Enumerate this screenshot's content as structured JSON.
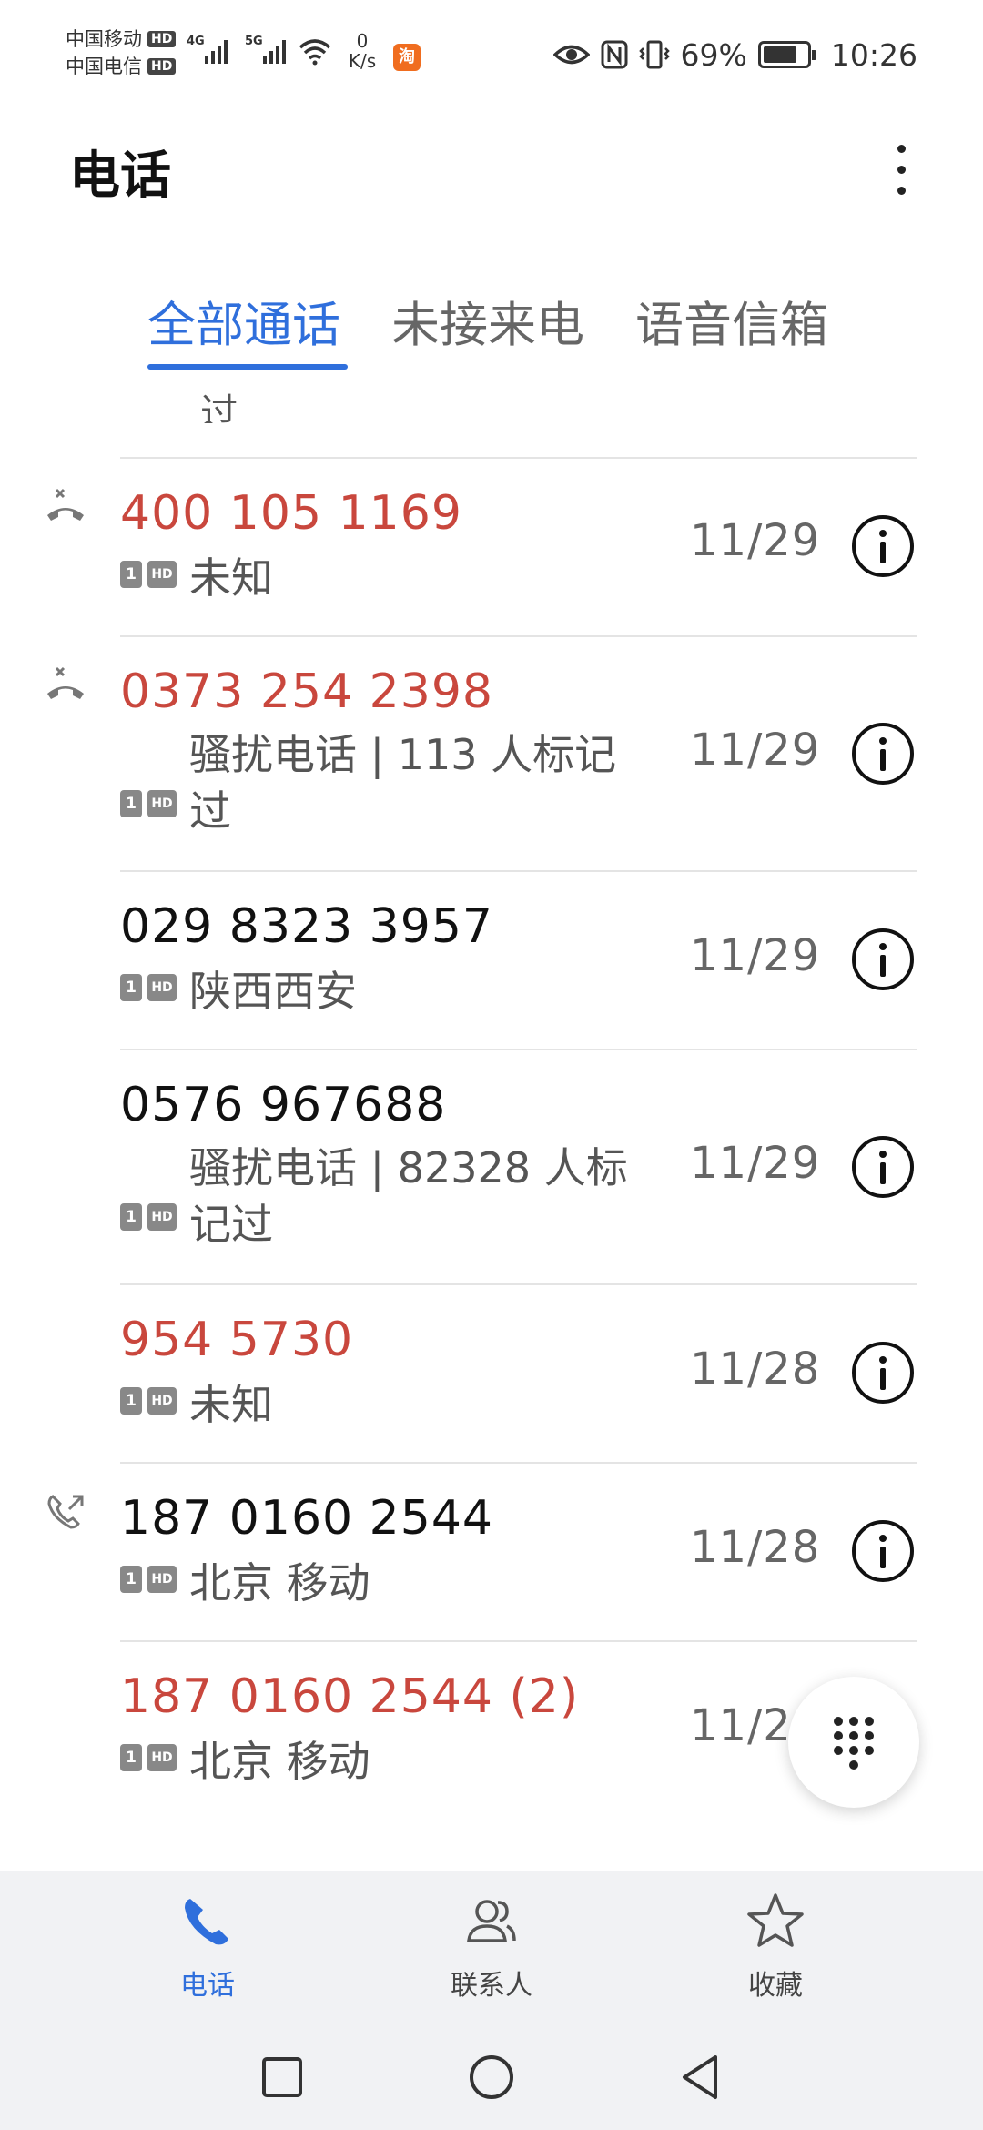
{
  "status_bar": {
    "carrier_1": "中国移动",
    "carrier_2": "中国电信",
    "hd_badge": "HD",
    "network_1": "4G",
    "network_2": "5G",
    "net_speed_value": "0",
    "net_speed_unit": "K/s",
    "taobao_icon_text": "淘",
    "battery_percent": "69%",
    "battery_level": 0.69,
    "time": "10:26"
  },
  "header": {
    "title": "电话"
  },
  "tabs": [
    {
      "label": "全部通话",
      "active": true
    },
    {
      "label": "未接来电",
      "active": false
    },
    {
      "label": "语音信箱",
      "active": false
    }
  ],
  "partial_previous_row_text": "过",
  "calls": [
    {
      "number": "400 105 1169",
      "status": "missed",
      "type_icon": "missed-call-icon",
      "sim": "1",
      "hd": "HD",
      "label": "未知",
      "date": "11/29"
    },
    {
      "number": "0373 254 2398",
      "status": "missed",
      "type_icon": "missed-call-icon",
      "sim": "1",
      "hd": "HD",
      "label": "骚扰电话 | 113 人标记过",
      "date": "11/29"
    },
    {
      "number": "029 8323 3957",
      "status": "normal",
      "type_icon": "",
      "sim": "1",
      "hd": "HD",
      "label": "陕西西安",
      "date": "11/29"
    },
    {
      "number": "0576 967688",
      "status": "normal",
      "type_icon": "",
      "sim": "1",
      "hd": "HD",
      "label": "骚扰电话 | 82328 人标记过",
      "date": "11/29"
    },
    {
      "number": "954 5730",
      "status": "missed",
      "type_icon": "",
      "sim": "1",
      "hd": "HD",
      "label": "未知",
      "date": "11/28"
    },
    {
      "number": "187 0160 2544",
      "status": "normal",
      "type_icon": "outgoing-call-icon",
      "sim": "1",
      "hd": "HD",
      "label": "北京 移动",
      "date": "11/28"
    },
    {
      "number": "187 0160 2544 (2)",
      "status": "missed",
      "type_icon": "",
      "sim": "1",
      "hd": "HD",
      "label": "北京 移动",
      "date": "11/28"
    }
  ],
  "bottom_nav": [
    {
      "label": "电话",
      "icon": "phone-icon",
      "active": true
    },
    {
      "label": "联系人",
      "icon": "contacts-icon",
      "active": false
    },
    {
      "label": "收藏",
      "icon": "star-icon",
      "active": false
    }
  ],
  "colors": {
    "accent": "#2f6fdc",
    "missed": "#c9473d"
  }
}
